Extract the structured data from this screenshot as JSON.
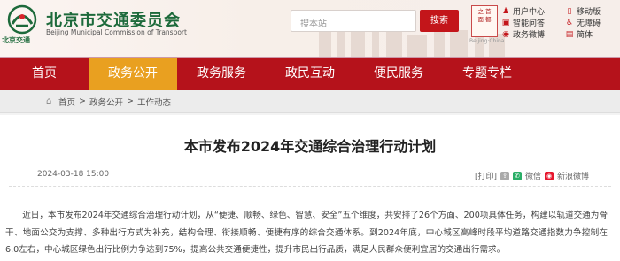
{
  "header": {
    "site_title": "北京市交通委员会",
    "site_subtitle": "Beijing Municipal Commission of Transport",
    "logo_text": "北京交通",
    "search": {
      "placeholder": "搜本站",
      "button_label": "搜索"
    },
    "seal_lines": [
      "之",
      "首",
      "面",
      "都"
    ],
    "seal_caption": "Beijing·China",
    "quick_links": [
      {
        "label": "用户中心",
        "icon": "user-icon"
      },
      {
        "label": "移动版",
        "icon": "mobile-icon"
      },
      {
        "label": "智能问答",
        "icon": "chat-icon"
      },
      {
        "label": "无障碍",
        "icon": "accessibility-icon"
      },
      {
        "label": "政务微博",
        "icon": "weibo-icon"
      },
      {
        "label": "简体",
        "icon": "language-icon"
      }
    ]
  },
  "nav": {
    "items": [
      "首页",
      "政务公开",
      "政务服务",
      "政民互动",
      "便民服务",
      "专题专栏"
    ],
    "active_index": 1
  },
  "breadcrumb": [
    "首页",
    "政务公开",
    "工作动态"
  ],
  "article": {
    "title": "本市发布2024年交通综合治理行动计划",
    "date": "2024-03-18 15:00",
    "print_label": "[打印]",
    "share_wechat": "微信",
    "share_weibo": "新浪微博",
    "body": "近日，本市发布2024年交通综合治理行动计划，从“便捷、顺畅、绿色、智慧、安全”五个维度，共安排了26个方面、200项具体任务，构建以轨道交通为骨干、地面公交为支撑、多种出行方式为补充，结构合理、衔接顺畅、便捷有序的综合交通体系。到2024年底，中心城区高峰时段平均道路交通指数力争控制在6.0左右，中心城区绿色出行比例力争达到75%，提高公共交通便捷性，提升市民出行品质，满足人民群众便利宜居的交通出行需求。"
  },
  "colors": {
    "nav_red": "#b5121b",
    "nav_active": "#e9a020",
    "brand_green": "#1d6a3b",
    "search_red": "#c3151a"
  }
}
